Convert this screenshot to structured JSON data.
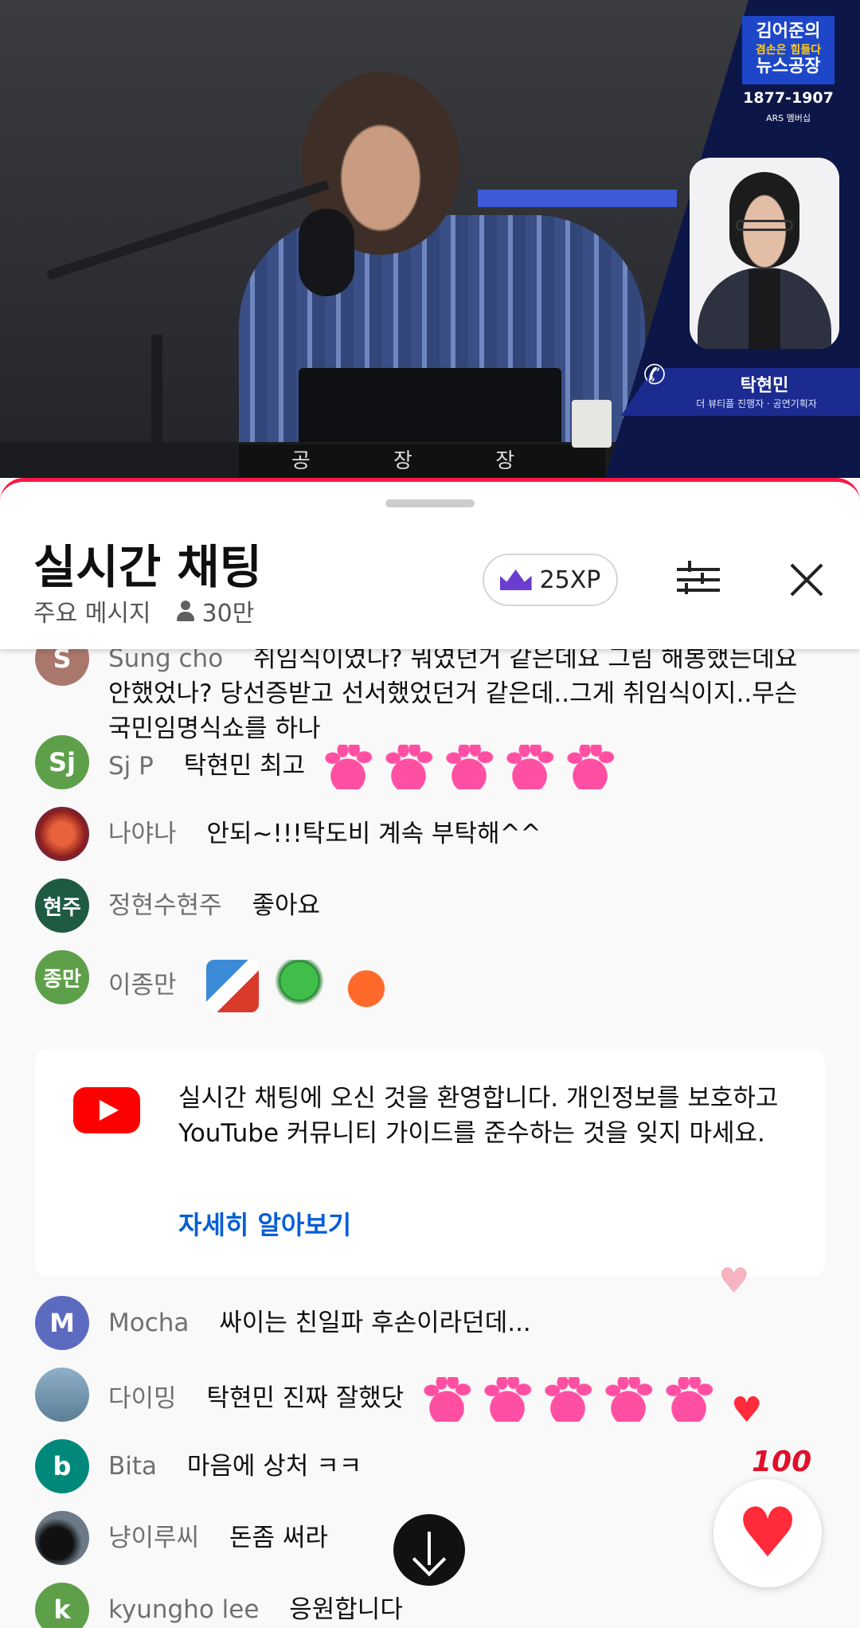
{
  "video": {
    "show_logo_line1": "김어준의",
    "show_logo_line2": "겸손은 힘들다",
    "show_logo_line3": "뉴스공장",
    "phone": "1877-1907",
    "ars": "ARS 멤버십",
    "guest_name": "탁현민",
    "guest_role": "더 뷰티플 진행자 · 공연기획자",
    "nameplate": "공 장 장"
  },
  "chat_header": {
    "title": "실시간 채팅",
    "mode": "주요 메시지",
    "viewers": "30만",
    "xp": "25XP"
  },
  "messages": [
    {
      "author": "Sung cho",
      "avatar": "S",
      "color": "#a9776b",
      "text": "취임식이였나? 뭐였던거 같은데요 그림 해봉했는데요 안했었나? 당선증받고 선서했었던거 같은데..그게 취임식이지..무슨 국민임명식쇼를 하나"
    },
    {
      "author": "Sj P",
      "avatar": "Sj",
      "color": "#5ea04a",
      "text": "탁현민 최고",
      "hands": 5
    },
    {
      "author": "나야나",
      "avatar": "",
      "color": "#b52a2a",
      "text": "안되~!!!탁도비 계속 부탁해^^"
    },
    {
      "author": "정현수현주",
      "avatar": "현주",
      "color": "#1f5b43",
      "text": "좋아요"
    },
    {
      "author": "이종만",
      "avatar": "종만",
      "color": "#5ea04a",
      "text": ""
    }
  ],
  "welcome": {
    "text": "실시간 채팅에 오신 것을 환영합니다. 개인정보를 보호하고 YouTube 커뮤니티 가이드를 준수하는 것을 잊지 마세요.",
    "link": "자세히 알아보기"
  },
  "messages2": [
    {
      "author": "Mocha",
      "avatar": "M",
      "color": "#5c6bc0",
      "text": "싸이는 친일파 후손이라던데..."
    },
    {
      "author": "다이밍",
      "avatar": "",
      "color": "#6e8ea8",
      "text": "탁현민 진짜 잘했닷",
      "hands": 5
    },
    {
      "author": "Bita",
      "avatar": "b",
      "color": "#00897b",
      "text": "마음에 상처 ㅋㅋ"
    },
    {
      "author": "냥이루씨",
      "avatar": "",
      "color": "#2a2f35",
      "text": "돈좀 써라"
    },
    {
      "author": "kyungho lee",
      "avatar": "k",
      "color": "#5ea04a",
      "text": "응원합니다"
    }
  ],
  "reactions": {
    "hundred": "100"
  }
}
